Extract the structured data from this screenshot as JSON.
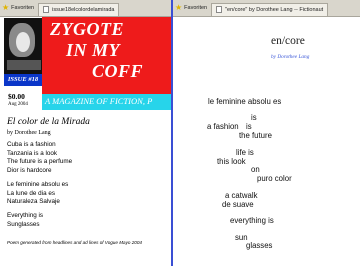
{
  "left_window": {
    "favorites_label": "Favoriten",
    "tab_title": "issue18elcolordelamirada",
    "zine": {
      "title_lines": [
        "ZYGOTE",
        "IN MY",
        "COFF"
      ],
      "issue_label": "ISSUE #18",
      "price": "$0.00",
      "date": "Aug 2004",
      "tagline": "A MAGAZINE OF FICTION, P"
    },
    "poem": {
      "title": "El color de la Mirada",
      "byline": "by Dorothee Lang",
      "stanza1": [
        "Cuba is a fashion",
        "Tanzania is a look",
        "The future is a perfume",
        "Dior is hardcore"
      ],
      "stanza2": [
        "Le feminine absolu es",
        "La lune de dia es",
        "Naturaleza Salvaje"
      ],
      "stanza3": [
        "Everything is",
        "Sunglasses"
      ],
      "footer_note": "Poem generated from headlines and ad lines of Vogue Mayo 2004"
    }
  },
  "right_window": {
    "favorites_label": "Favoriten",
    "tab_title": "\"en/core\" by Dorothee Lang -- Fictionaut",
    "poem": {
      "title": "en/core",
      "byline": "by Dorothee Lang",
      "words": [
        "le feminine absolu es",
        "is",
        "a fashion",
        "is",
        "the future",
        "life is",
        "this look",
        "on",
        "puro color",
        "a catwalk",
        "de suave",
        "everything is",
        "sun",
        "glasses"
      ]
    }
  },
  "colors": {
    "divider": "#3a4fd4",
    "zine_red": "#ee1b1b",
    "zine_cyan": "#27d4ea",
    "issue_blue": "#0a36c9",
    "byline_blue": "#3a57d8"
  }
}
